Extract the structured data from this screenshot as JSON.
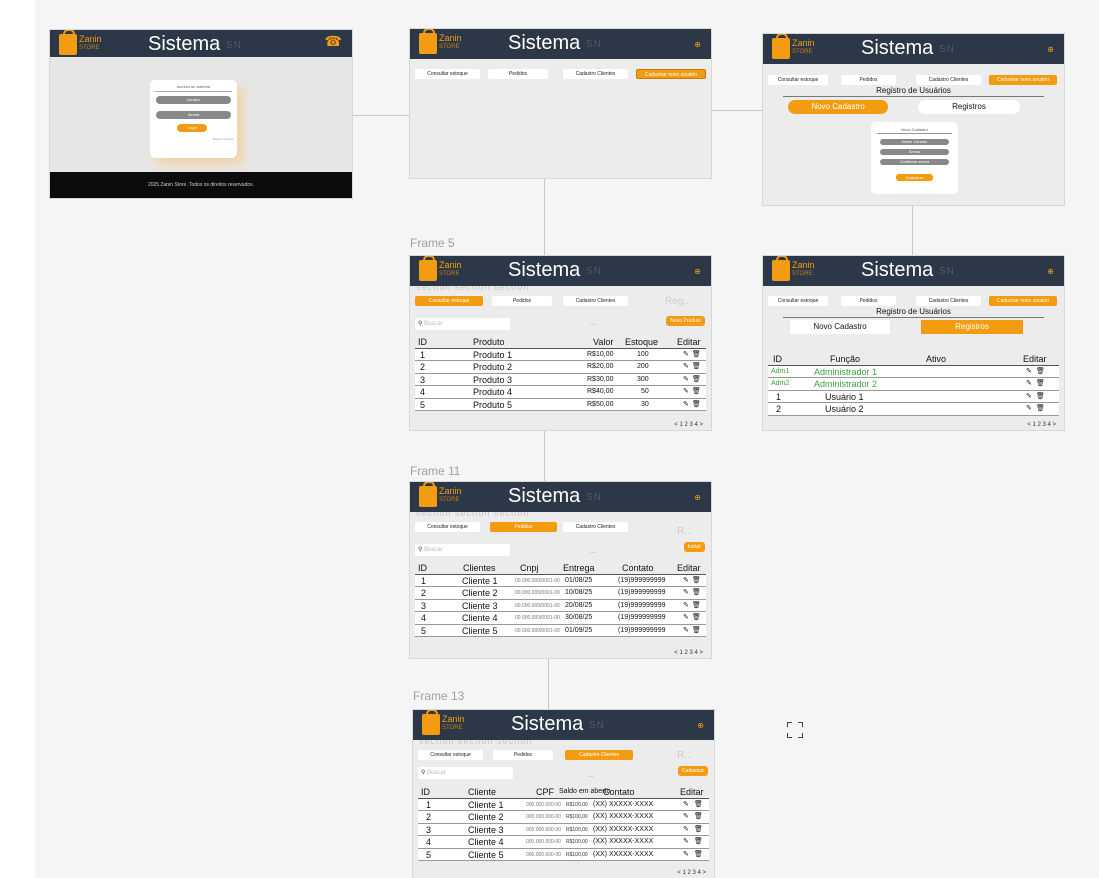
{
  "header": {
    "brand": "Zanin",
    "brand_sub": "STORE",
    "title": "Sistema",
    "ghost": "SN"
  },
  "frame_labels": [
    "Frame 5",
    "Frame 11",
    "Frame 13"
  ],
  "tabs": [
    "Consultar estoque",
    "Pedidos",
    "Cadastro Clientes",
    "Cadastrar novo usuário"
  ],
  "login": {
    "heading": "Acesso ao sistema",
    "user": "Usuário",
    "password": "Senha",
    "button": "Logar",
    "forgot": "Esqueci Senha",
    "footer": "2025 Zanin Store. Todos os direitos reservados."
  },
  "cadastro": {
    "title": "Registro de Usuários",
    "tab_new": "Novo Cadastro",
    "tab_records": "Registros",
    "form_title": "Novo Cadastro",
    "fields": [
      "Nome Usuário",
      "Senha",
      "Confirmar senha"
    ],
    "submit": "Cadastrar"
  },
  "common": {
    "search": "Buscar",
    "register_short": "Reg...",
    "r_short": "R...",
    "dots": "...",
    "ghost_section": "section   section   section"
  },
  "estoque": {
    "button": "Novo Produto",
    "headers": [
      "ID",
      "Produto",
      "Valor",
      "Estoque",
      "Editar"
    ],
    "rows": [
      [
        "1",
        "Produto 1",
        "R$10,00",
        "100"
      ],
      [
        "2",
        "Produto 2",
        "R$20,00",
        "200"
      ],
      [
        "3",
        "Produto 3",
        "R$30,00",
        "300"
      ],
      [
        "4",
        "Produto 4",
        "R$40,00",
        "50"
      ],
      [
        "5",
        "Produto 5",
        "R$50,00",
        "30"
      ]
    ]
  },
  "registros": {
    "headers": [
      "ID",
      "Função",
      "Ativo",
      "Editar"
    ],
    "rows": [
      [
        "Adm1",
        "Administrador 1"
      ],
      [
        "Adm2",
        "Administrador 2"
      ],
      [
        "1",
        "Usuário 1"
      ],
      [
        "2",
        "Usuário 2"
      ]
    ]
  },
  "pedidos": {
    "button": "Incluir",
    "headers": [
      "ID",
      "Clientes",
      "Cnpj",
      "Entrega",
      "Contato",
      "Editar"
    ],
    "rows": [
      [
        "1",
        "Cliente 1",
        "00.000.000/0001-00",
        "01/08/25",
        "(19)999999999"
      ],
      [
        "2",
        "Cliente 2",
        "00.000.000/0001-00",
        "10/08/25",
        "(19)999999999"
      ],
      [
        "3",
        "Cliente 3",
        "00.000.000/0001-00",
        "20/08/25",
        "(19)999999999"
      ],
      [
        "4",
        "Cliente 4",
        "00.000.000/0001-00",
        "30/08/25",
        "(19)999999999"
      ],
      [
        "5",
        "Cliente 5",
        "00.000.000/0001-00",
        "01/09/25",
        "(19)999999999"
      ]
    ]
  },
  "clientes": {
    "button": "Cadastrar",
    "headers": [
      "ID",
      "Cliente",
      "CPF",
      "Saldo em aberto",
      "Contato",
      "Editar"
    ],
    "rows": [
      [
        "1",
        "Cliente 1",
        "000.000.000-00",
        "R$100,00",
        "(XX) XXXXX-XXXX"
      ],
      [
        "2",
        "Cliente 2",
        "000.000.000-00",
        "R$100,00",
        "(XX) XXXXX-XXXX"
      ],
      [
        "3",
        "Cliente 3",
        "000.000.000-00",
        "R$100,00",
        "(XX) XXXXX-XXXX"
      ],
      [
        "4",
        "Cliente 4",
        "000.000.000-00",
        "R$100,00",
        "(XX) XXXXX-XXXX"
      ],
      [
        "5",
        "Cliente 5",
        "000.000.000-00",
        "R$100,00",
        "(XX) XXXXX-XXXX"
      ]
    ]
  },
  "pagination": "< 1 2 3 4 >",
  "icons": {
    "edit": "✎",
    "delete": "🗑",
    "gear": "⊕",
    "avatar": "☎"
  },
  "colors": {
    "header": "#2c3848",
    "accent": "#f39c12",
    "admin_text": "#3aa63a"
  }
}
